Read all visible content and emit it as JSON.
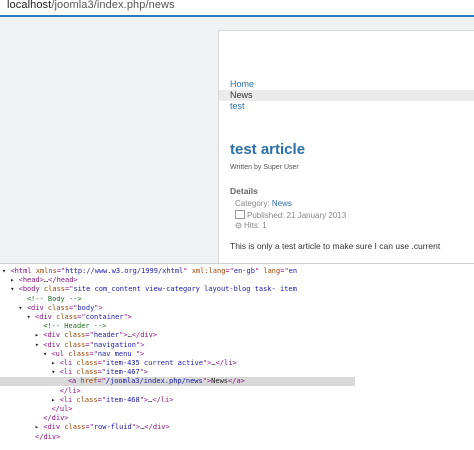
{
  "browser": {
    "url_host": "localhost",
    "url_path": "/joomla3/index.php/news"
  },
  "page": {
    "nav": [
      {
        "label": "Home",
        "active": false
      },
      {
        "label": "News",
        "active": true
      },
      {
        "label": "test",
        "active": false
      }
    ],
    "article_title": "test article",
    "byline": "Written by Super User",
    "details_heading": "Details",
    "category_label": "Category:",
    "category_value": "News",
    "published": "Published: 21 January 2013",
    "hits": "Hits: 1",
    "body_text": "This is only a test article to make sure I can use .current"
  },
  "devtools": {
    "lines": [
      {
        "indent": 0,
        "arrow": "▼",
        "parts": [
          [
            "tag",
            "<html "
          ],
          [
            "attr",
            "xmlns"
          ],
          [
            "tag",
            "=\""
          ],
          [
            "val",
            "http://www.w3.org/1999/xhtml"
          ],
          [
            "tag",
            "\" "
          ],
          [
            "attr",
            "xml:lang"
          ],
          [
            "tag",
            "=\""
          ],
          [
            "val",
            "en-gb"
          ],
          [
            "tag",
            "\" "
          ],
          [
            "attr",
            "lang"
          ],
          [
            "tag",
            "=\""
          ],
          [
            "val",
            "en"
          ]
        ]
      },
      {
        "indent": 1,
        "arrow": "▶",
        "parts": [
          [
            "tag",
            "<head>"
          ],
          [
            "txt",
            "…"
          ],
          [
            "tag",
            "</head>"
          ]
        ]
      },
      {
        "indent": 1,
        "arrow": "▼",
        "parts": [
          [
            "tag",
            "<body "
          ],
          [
            "attr",
            "class"
          ],
          [
            "tag",
            "=\""
          ],
          [
            "val",
            "site com_content view-category layout-blog task- item"
          ]
        ]
      },
      {
        "indent": 2,
        "arrow": "",
        "parts": [
          [
            "cmt",
            "<!-- Body -->"
          ]
        ]
      },
      {
        "indent": 2,
        "arrow": "▼",
        "parts": [
          [
            "tag",
            "<div "
          ],
          [
            "attr",
            "class"
          ],
          [
            "tag",
            "=\""
          ],
          [
            "val",
            "body"
          ],
          [
            "tag",
            "\">"
          ]
        ]
      },
      {
        "indent": 3,
        "arrow": "▼",
        "parts": [
          [
            "tag",
            "<div "
          ],
          [
            "attr",
            "class"
          ],
          [
            "tag",
            "=\""
          ],
          [
            "val",
            "container"
          ],
          [
            "tag",
            "\">"
          ]
        ]
      },
      {
        "indent": 4,
        "arrow": "",
        "parts": [
          [
            "cmt",
            "<!-- Header -->"
          ]
        ]
      },
      {
        "indent": 4,
        "arrow": "▶",
        "parts": [
          [
            "tag",
            "<div "
          ],
          [
            "attr",
            "class"
          ],
          [
            "tag",
            "=\""
          ],
          [
            "val",
            "header"
          ],
          [
            "tag",
            "\">"
          ],
          [
            "txt",
            "…"
          ],
          [
            "tag",
            "</div>"
          ]
        ]
      },
      {
        "indent": 4,
        "arrow": "▼",
        "parts": [
          [
            "tag",
            "<div "
          ],
          [
            "attr",
            "class"
          ],
          [
            "tag",
            "=\""
          ],
          [
            "val",
            "navigation"
          ],
          [
            "tag",
            "\">"
          ]
        ]
      },
      {
        "indent": 5,
        "arrow": "▼",
        "parts": [
          [
            "tag",
            "<ul "
          ],
          [
            "attr",
            "class"
          ],
          [
            "tag",
            "=\""
          ],
          [
            "val",
            "nav menu "
          ],
          [
            "tag",
            "\">"
          ]
        ]
      },
      {
        "indent": 6,
        "arrow": "▶",
        "parts": [
          [
            "tag",
            "<li "
          ],
          [
            "attr",
            "class"
          ],
          [
            "tag",
            "=\""
          ],
          [
            "val",
            "item-435 current active"
          ],
          [
            "tag",
            "\">"
          ],
          [
            "txt",
            "…"
          ],
          [
            "tag",
            "</li>"
          ]
        ]
      },
      {
        "indent": 6,
        "arrow": "▼",
        "parts": [
          [
            "tag",
            "<li "
          ],
          [
            "attr",
            "class"
          ],
          [
            "tag",
            "=\""
          ],
          [
            "val",
            "item-467"
          ],
          [
            "tag",
            "\">"
          ]
        ]
      },
      {
        "indent": 7,
        "arrow": "",
        "sel": true,
        "parts": [
          [
            "tag",
            "<a "
          ],
          [
            "attr",
            "href"
          ],
          [
            "tag",
            "=\""
          ],
          [
            "val",
            "/joomla3/index.php/news"
          ],
          [
            "tag",
            "\">"
          ],
          [
            "txt",
            "News"
          ],
          [
            "tag",
            "</a>"
          ]
        ]
      },
      {
        "indent": 6,
        "arrow": "",
        "parts": [
          [
            "tag",
            "</li>"
          ]
        ]
      },
      {
        "indent": 6,
        "arrow": "▶",
        "parts": [
          [
            "tag",
            "<li "
          ],
          [
            "attr",
            "class"
          ],
          [
            "tag",
            "=\""
          ],
          [
            "val",
            "item-468"
          ],
          [
            "tag",
            "\">"
          ],
          [
            "txt",
            "…"
          ],
          [
            "tag",
            "</li>"
          ]
        ]
      },
      {
        "indent": 5,
        "arrow": "",
        "parts": [
          [
            "tag",
            "</ul>"
          ]
        ]
      },
      {
        "indent": 4,
        "arrow": "",
        "parts": [
          [
            "tag",
            "</div>"
          ]
        ]
      },
      {
        "indent": 4,
        "arrow": "▶",
        "parts": [
          [
            "tag",
            "<div "
          ],
          [
            "attr",
            "class"
          ],
          [
            "tag",
            "=\""
          ],
          [
            "val",
            "row-fluid"
          ],
          [
            "tag",
            "\">"
          ],
          [
            "txt",
            "…"
          ],
          [
            "tag",
            "</div>"
          ]
        ]
      },
      {
        "indent": 3,
        "arrow": "",
        "parts": [
          [
            "tag",
            "</div>"
          ]
        ]
      }
    ]
  }
}
